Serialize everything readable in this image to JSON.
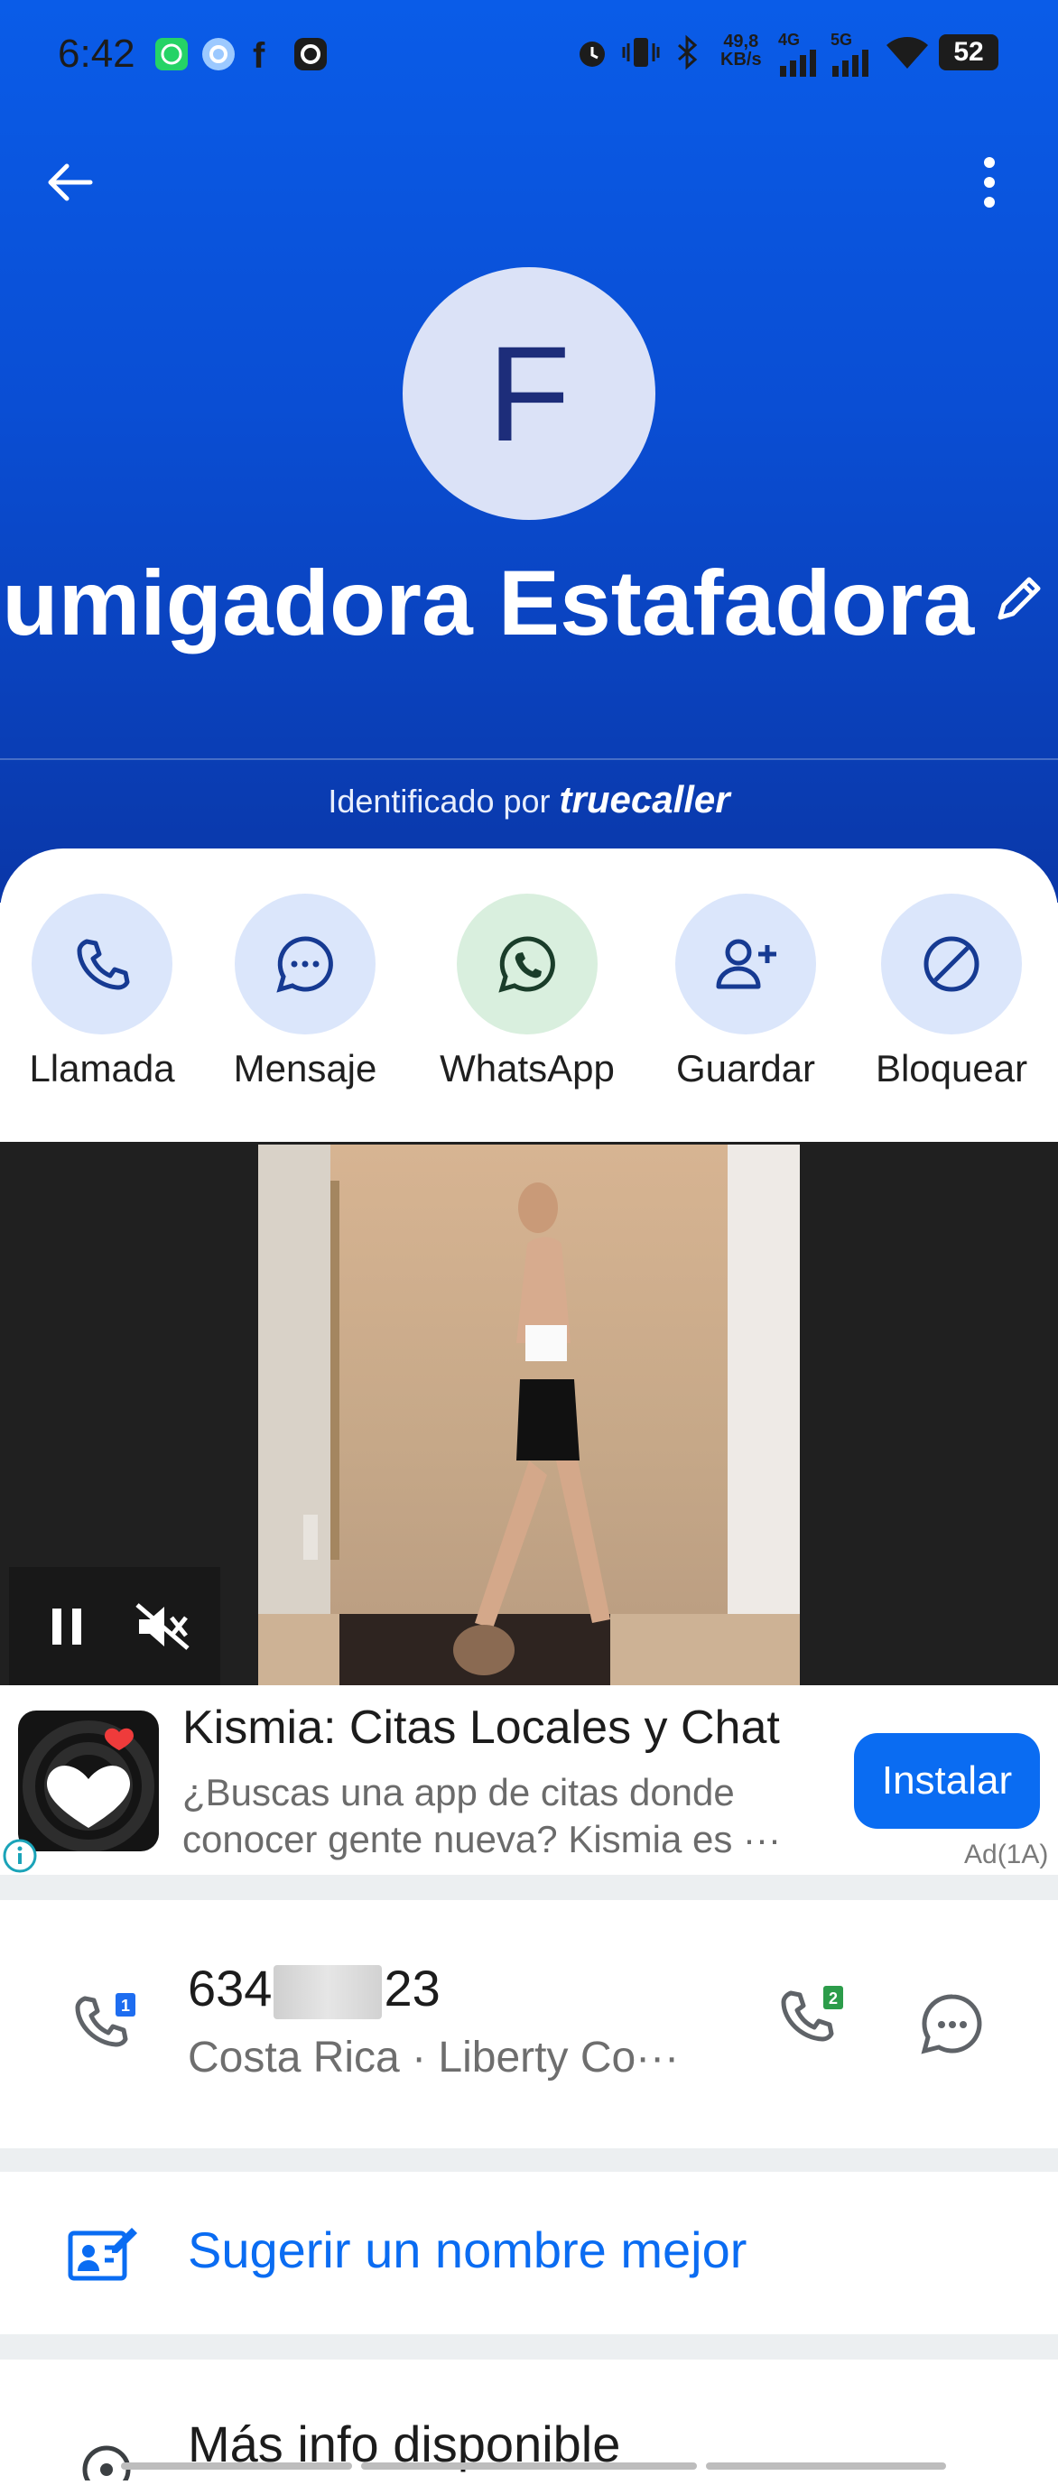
{
  "status_bar": {
    "time": "6:42",
    "speed_value": "49,8",
    "speed_unit": "KB/s",
    "net1": "4G",
    "net2": "5G",
    "battery": "52"
  },
  "contact": {
    "avatar_letter": "F",
    "name": "Fumigadora Estafadora",
    "identified_prefix": "Identificado por",
    "identified_brand": "truecaller"
  },
  "actions": [
    {
      "label": "Llamada",
      "icon": "phone-icon"
    },
    {
      "label": "Mensaje",
      "icon": "message-icon"
    },
    {
      "label": "WhatsApp",
      "icon": "whatsapp-icon"
    },
    {
      "label": "Guardar",
      "icon": "add-contact-icon"
    },
    {
      "label": "Bloquear",
      "icon": "block-icon"
    }
  ],
  "ad": {
    "title": "Kismia: Citas Locales y Chat",
    "description": "¿Buscas una app de citas donde conocer gente nueva? Kismia es ···",
    "install_label": "Instalar",
    "tag": "Ad(1A)"
  },
  "number": {
    "prefix": "634",
    "suffix": "23",
    "location": "Costa Rica · Liberty Co···",
    "sim1": "1",
    "sim2": "2"
  },
  "suggest_label": "Sugerir un nombre mejor",
  "more_info_label": "Más info disponible",
  "colors": {
    "accent": "#0a6cf2",
    "header": "#0a5ce8"
  }
}
